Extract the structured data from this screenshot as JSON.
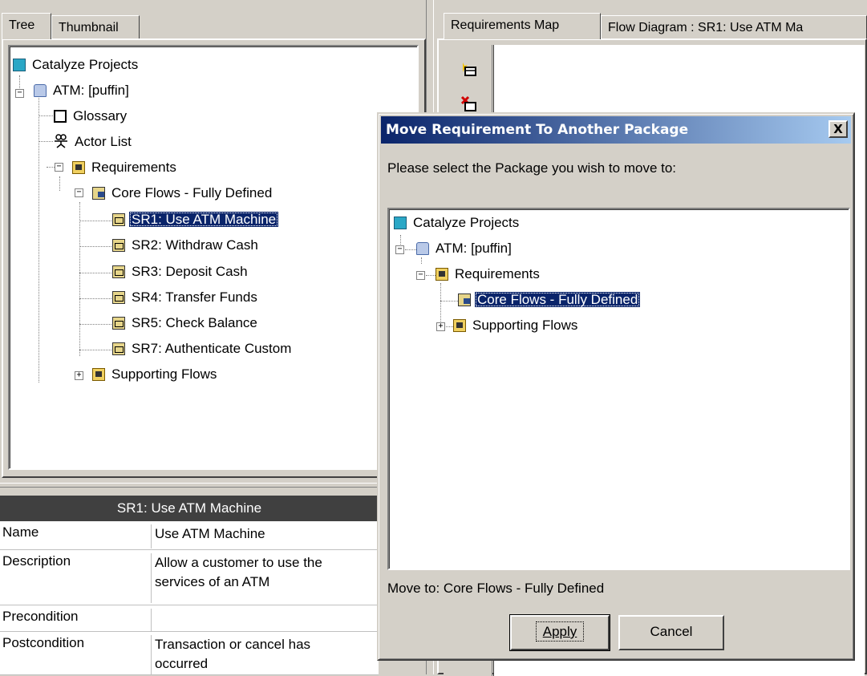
{
  "left_tabs": [
    "Tree",
    "Thumbnail"
  ],
  "right_tabs": [
    "Requirements Map",
    "Flow Diagram : SR1: Use ATM Ma"
  ],
  "tree": {
    "root": "Catalyze Projects",
    "project": "ATM: [puffin]",
    "glossary": "Glossary",
    "actors": "Actor List",
    "requirements": "Requirements",
    "core_flows": "Core Flows - Fully Defined",
    "items": [
      "SR1: Use ATM Machine",
      "SR2: Withdraw Cash",
      "SR3: Deposit Cash",
      "SR4: Transfer Funds",
      "SR5: Check Balance",
      "SR7: Authenticate Custom"
    ],
    "supporting": "Supporting Flows"
  },
  "properties": {
    "header": "SR1: Use ATM Machine",
    "rows": [
      {
        "key": "Name",
        "value": "Use ATM Machine"
      },
      {
        "key": "Description",
        "value": "Allow a customer to use the services of an ATM"
      },
      {
        "key": "Precondition",
        "value": ""
      },
      {
        "key": "Postcondition",
        "value": "Transaction or cancel has occurred"
      }
    ]
  },
  "dialog": {
    "title": "Move Requirement To Another Package",
    "close": "X",
    "prompt": "Please select the Package you wish to move to:",
    "tree": {
      "root": "Catalyze Projects",
      "project": "ATM: [puffin]",
      "requirements": "Requirements",
      "core_flows": "Core Flows - Fully Defined",
      "supporting": "Supporting Flows"
    },
    "move_to": "Move to: Core Flows - Fully Defined",
    "apply": "Apply",
    "cancel": "Cancel"
  }
}
